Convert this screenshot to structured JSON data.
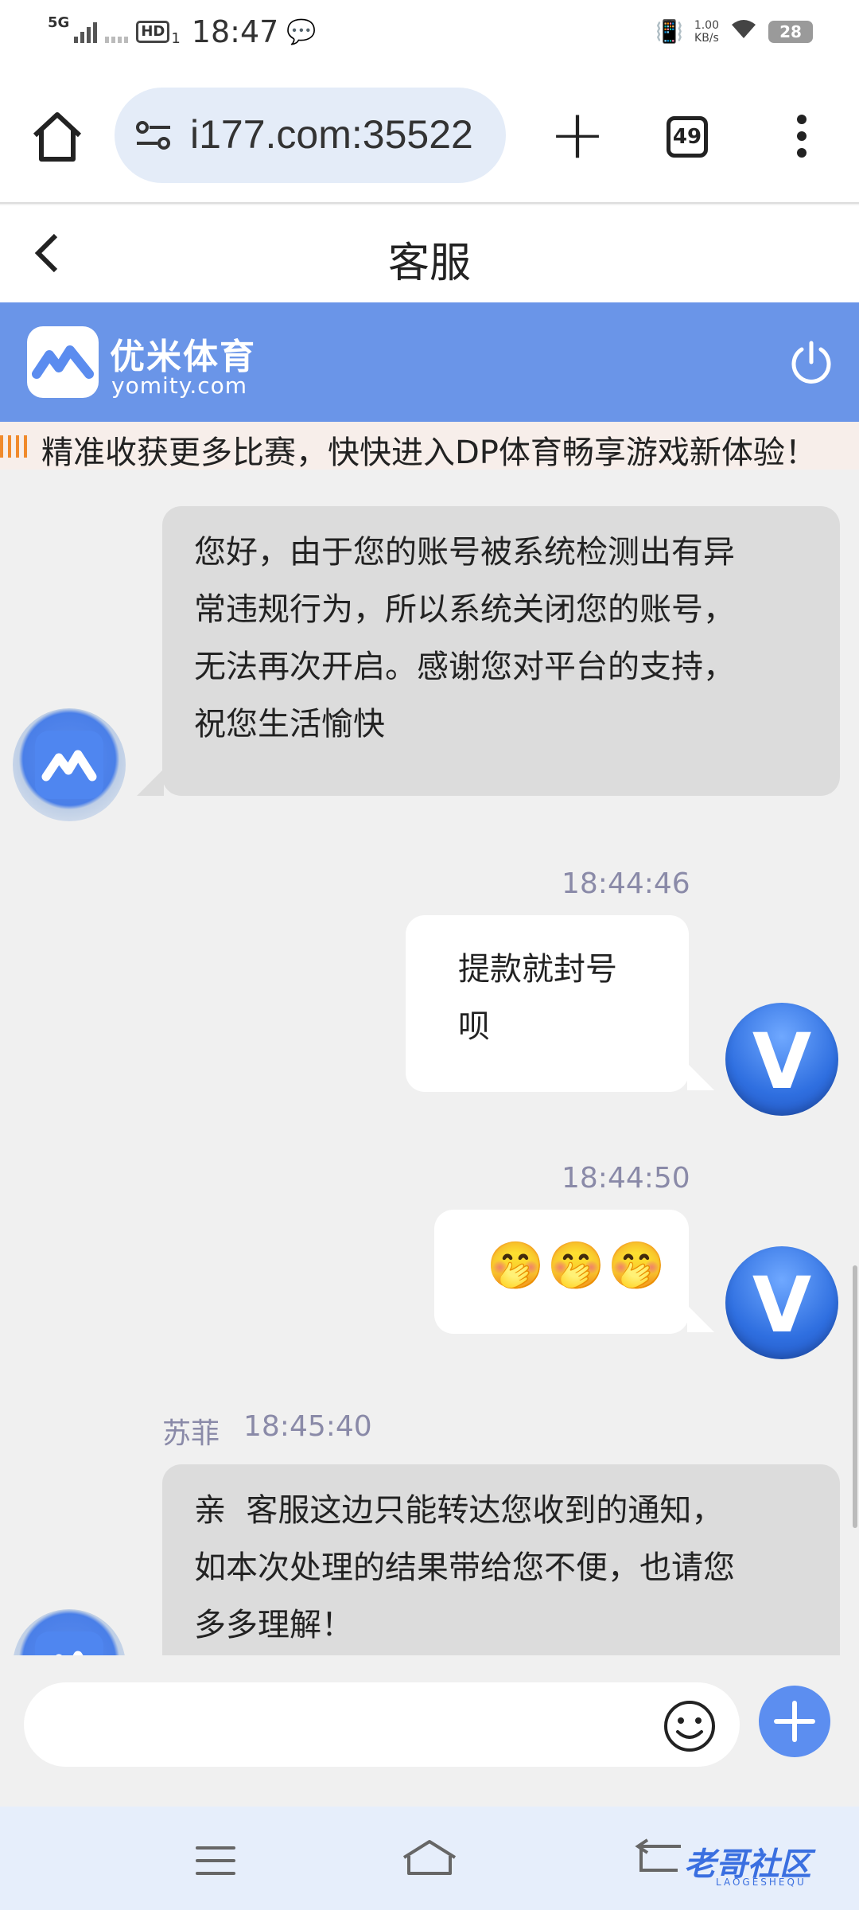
{
  "status_bar": {
    "network": "5G",
    "hd": "HD",
    "sim": "1",
    "time": "18:47",
    "speed_value": "1.00",
    "speed_unit": "KB/s",
    "battery": "28"
  },
  "browser": {
    "url": "i177.com:35522",
    "tab_count": "49"
  },
  "page": {
    "title": "客服"
  },
  "brand": {
    "name": "优米体育",
    "url": "yomity.com"
  },
  "announcement": "精准收获更多比赛，快快进入DP体育畅享游戏新体验！",
  "messages": [
    {
      "side": "left",
      "lines": [
        "您好，由于您的账号被系统检测出有异",
        "常违规行为，所以系统关闭您的账号，",
        "无法再次开启。感谢您对平台的支持，",
        "祝您生活愉快"
      ]
    },
    {
      "side": "right",
      "time": "18:44:46",
      "lines": [
        "提款就封号",
        "呗"
      ]
    },
    {
      "side": "right",
      "time": "18:44:50",
      "text": "🤭🤭🤭"
    },
    {
      "side": "left",
      "sender": "苏菲",
      "time": "18:45:40",
      "lines": [
        "亲  客服这边只能转达您收到的通知，",
        "如本次处理的结果带给您不便，也请您",
        "多多理解！"
      ]
    }
  ],
  "user_avatar_letter": "V",
  "input": {
    "placeholder": ""
  },
  "icons": {
    "home": "home-icon",
    "site_info": "site-settings-icon",
    "new_tab": "plus-icon",
    "tabs": "tab-switcher-icon",
    "menu": "more-vert-icon",
    "back": "chevron-left-icon",
    "power": "power-icon",
    "emoji": "smile-icon",
    "add": "add-circle-icon"
  },
  "watermark": {
    "text": "老哥社区",
    "sub": "LAOGESHEQU"
  },
  "colors": {
    "brand_blue": "#6a95e8",
    "agent_bubble": "#dcdcdc",
    "user_bubble": "#ffffff",
    "timestamp": "#8a8aa8"
  }
}
